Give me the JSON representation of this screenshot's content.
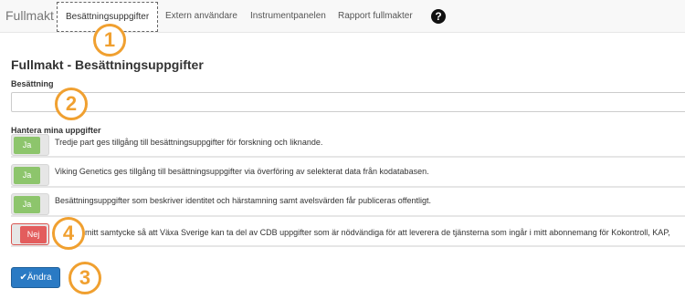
{
  "navbar": {
    "brand": "Fullmakt",
    "tabs": [
      {
        "label": "Besättningsuppgifter"
      },
      {
        "label": "Extern användare"
      },
      {
        "label": "Instrumentpanelen"
      },
      {
        "label": "Rapport fullmakter"
      }
    ],
    "help_glyph": "?"
  },
  "markers": [
    "1",
    "2",
    "3",
    "4"
  ],
  "page": {
    "title": "Fullmakt - Besättningsuppgifter",
    "herd_label": "Besättning",
    "herd_value": "",
    "manage_label": "Hantera mina uppgifter"
  },
  "permissions": [
    {
      "state": "Ja",
      "text": "Tredje part ges tillgång till besättningsuppgifter för forskning och liknande."
    },
    {
      "state": "Ja",
      "text": "Viking Genetics ges tillgång till besättningsuppgifter via överföring av selekterat data från kodatabasen."
    },
    {
      "state": "Ja",
      "text": "Besättningsuppgifter som beskriver identitet och härstamning samt avelsvärden får publiceras offentligt."
    },
    {
      "state": "Nej",
      "text": "mitt samtycke så att Växa Sverige kan ta del av CDB uppgifter som är nödvändiga för att leverera de tjänsterna som ingår i mitt abonnemang för Kokontroll, KAP,"
    }
  ],
  "actions": {
    "change_label": "✔Ändra"
  },
  "colors": {
    "toggle_on": "#8dc56c",
    "toggle_off": "#e35d5d",
    "primary": "#2a7ac4",
    "marker": "#f0a030"
  }
}
